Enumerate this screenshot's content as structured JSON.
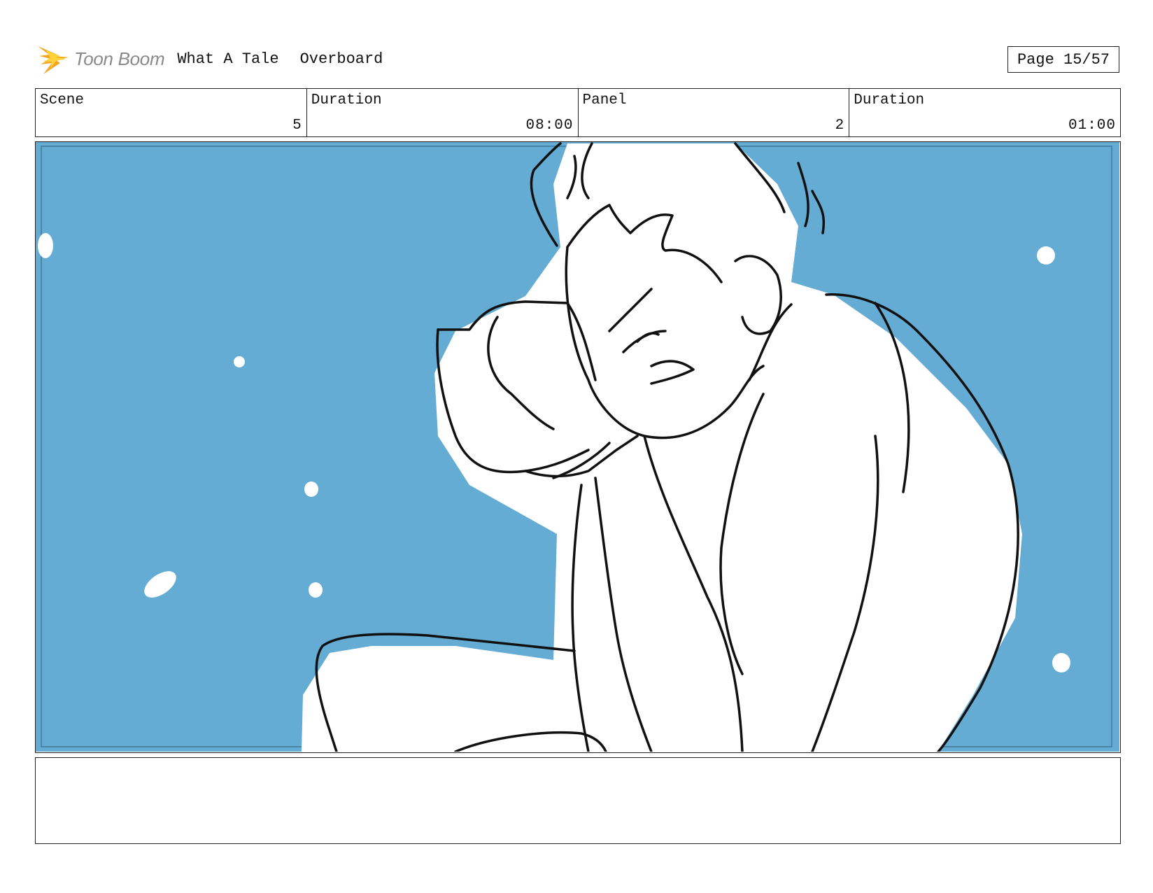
{
  "header": {
    "logo_text": "Toon Boom",
    "project_title": "What A Tale",
    "sequence_title": "Overboard",
    "page_label": "Page 15/57"
  },
  "info": {
    "scene_label": "Scene",
    "scene_value": "5",
    "scene_duration_label": "Duration",
    "scene_duration_value": "08:00",
    "panel_label": "Panel",
    "panel_value": "2",
    "panel_duration_label": "Duration",
    "panel_duration_value": "01:00"
  },
  "panel_image": {
    "background_color": "#65acd4",
    "sketch_color": "#111111",
    "fill_color": "#ffffff"
  },
  "notes": {
    "text": ""
  },
  "colors": {
    "logo_orange": "#f5a623",
    "logo_yellow": "#ffd23a",
    "frame_border": "#222222",
    "inner_frame": "#4a86a8"
  }
}
